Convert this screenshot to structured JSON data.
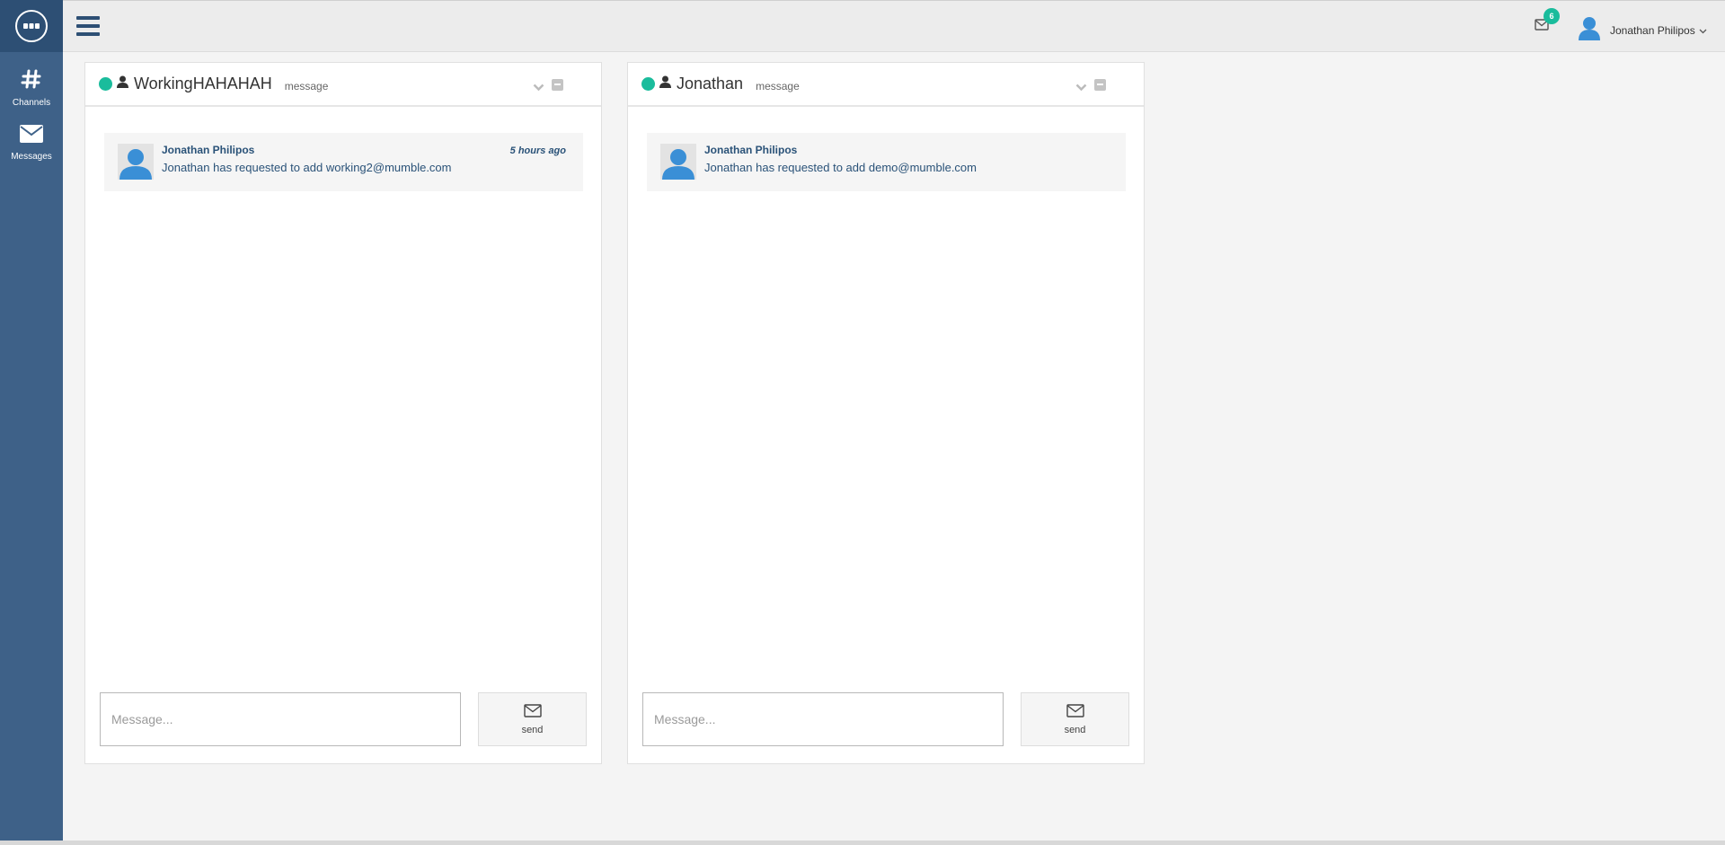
{
  "sidebar": {
    "items": [
      {
        "label": "Channels",
        "icon": "hash-icon"
      },
      {
        "label": "Messages",
        "icon": "envelope-icon"
      }
    ]
  },
  "topbar": {
    "notification_count": "6",
    "user_name": "Jonathan Philipos"
  },
  "panels": [
    {
      "title": "WorkingHAHAHAH",
      "subtitle": "message",
      "status": "online",
      "messages": [
        {
          "author": "Jonathan Philipos",
          "text": "Jonathan has requested to add working2@mumble.com",
          "time": "5 hours ago"
        }
      ],
      "input_placeholder": "Message...",
      "send_label": "send"
    },
    {
      "title": "Jonathan",
      "subtitle": "message",
      "status": "online",
      "messages": [
        {
          "author": "Jonathan Philipos",
          "text": "Jonathan has requested to add demo@mumble.com",
          "time": ""
        }
      ],
      "input_placeholder": "Message...",
      "send_label": "send"
    }
  ],
  "colors": {
    "sidebar": "#3e6188",
    "logo_bg": "#2d4f74",
    "online": "#1abc9c",
    "link_text": "#2a5278"
  }
}
